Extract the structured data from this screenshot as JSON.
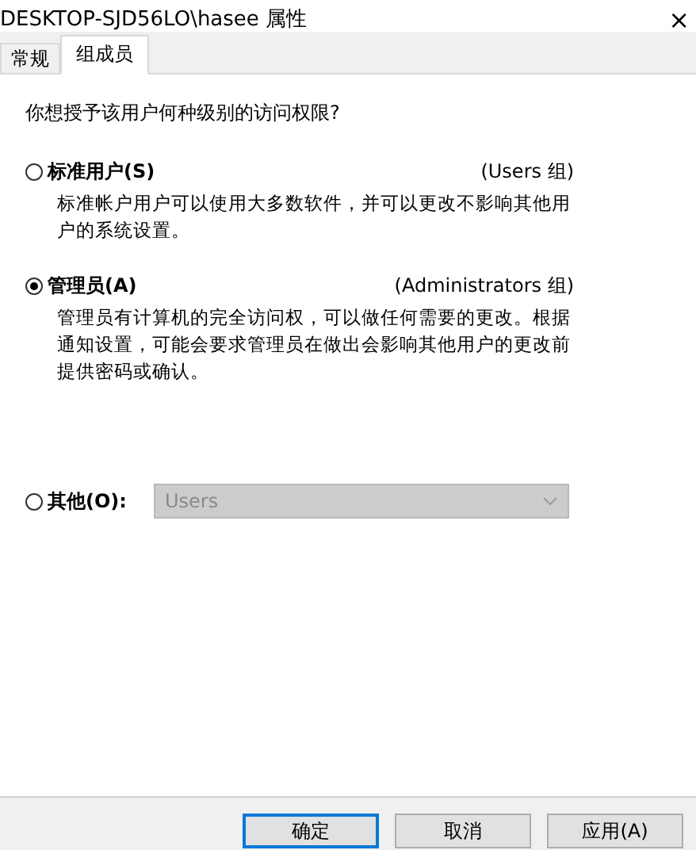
{
  "window": {
    "title": "DESKTOP-SJD56LO\\hasee 属性",
    "close": "×"
  },
  "tabs": [
    {
      "label": "常规",
      "selected": false
    },
    {
      "label": "组成员",
      "selected": true
    }
  ],
  "prompt": "你想授予该用户何种级别的访问权限?",
  "options": [
    {
      "kind": "group",
      "label": "标准用户(S)",
      "group": "(Users 组)",
      "description": "标准帐户用户可以使用大多数软件，并可以更改不影响其他用户的系统设置。",
      "selected": false
    },
    {
      "kind": "group",
      "label": "管理员(A)",
      "group": "(Administrators 组)",
      "description": "管理员有计算机的完全访问权，可以做任何需要的更改。根据通知设置，可能会要求管理员在做出会影响其他用户的更改前提供密码或确认。",
      "selected": true
    },
    {
      "kind": "dropdown",
      "label": "其他(O):",
      "value": "Users",
      "disabled": true,
      "selected": false
    }
  ],
  "buttons": [
    {
      "label": "确定",
      "default": true
    },
    {
      "label": "取消",
      "default": false
    },
    {
      "label": "应用(A)",
      "default": false
    }
  ]
}
